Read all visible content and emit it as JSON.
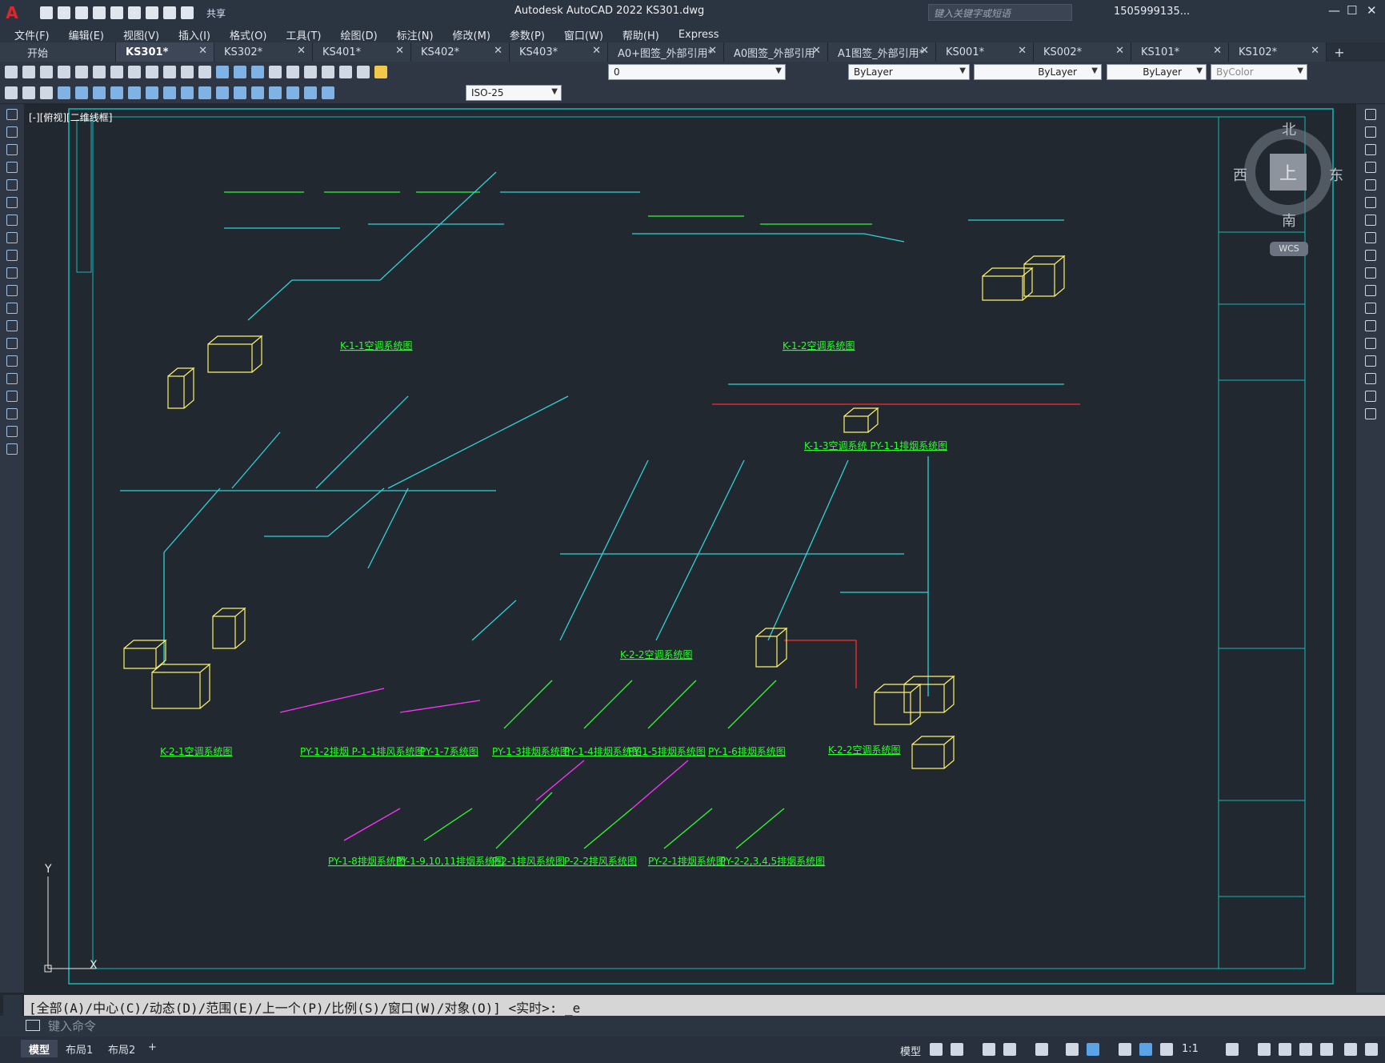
{
  "app": {
    "logo_letter": "A",
    "title": "Autodesk AutoCAD 2022    KS301.dwg",
    "share_label": "共享",
    "search_placeholder": "键入关键字或短语",
    "user": "1505999135..."
  },
  "menu": [
    "文件(F)",
    "编辑(E)",
    "视图(V)",
    "插入(I)",
    "格式(O)",
    "工具(T)",
    "绘图(D)",
    "标注(N)",
    "修改(M)",
    "参数(P)",
    "窗口(W)",
    "帮助(H)",
    "Express"
  ],
  "tabs": [
    {
      "label": "开始",
      "active": false,
      "closable": false
    },
    {
      "label": "KS301*",
      "active": true,
      "closable": true
    },
    {
      "label": "KS302*",
      "active": false,
      "closable": true
    },
    {
      "label": "KS401*",
      "active": false,
      "closable": true
    },
    {
      "label": "KS402*",
      "active": false,
      "closable": true
    },
    {
      "label": "KS403*",
      "active": false,
      "closable": true
    },
    {
      "label": "A0+图签_外部引用*",
      "active": false,
      "closable": true
    },
    {
      "label": "A0图签_外部引用",
      "active": false,
      "closable": true
    },
    {
      "label": "A1图签_外部引用*",
      "active": false,
      "closable": true
    },
    {
      "label": "KS001*",
      "active": false,
      "closable": true
    },
    {
      "label": "KS002*",
      "active": false,
      "closable": true
    },
    {
      "label": "KS101*",
      "active": false,
      "closable": true
    },
    {
      "label": "KS102*",
      "active": false,
      "closable": true
    }
  ],
  "properties": {
    "layer": "0",
    "color": "ByLayer",
    "linetype": "ByLayer",
    "lineweight": "ByLayer",
    "plotstyle": "ByColor",
    "dimstyle": "ISO-25"
  },
  "viewport": {
    "label": "[-][俯视][二维线框]",
    "cube_top": "上",
    "north": "北",
    "south": "南",
    "east": "东",
    "west": "西",
    "wcs": "WCS"
  },
  "drawing_titles": [
    "K-1-1空调系统图",
    "K-1-2空调系统图",
    "K-1-3空调系统 PY-1-1排烟系统图",
    "K-2-2空调系统图",
    "K-2-1空调系统图",
    "PY-1-2排烟 P-1-1排风系统图",
    "PY-1-7系统图",
    "PY-1-3排烟系统图",
    "PY-1-4排烟系统图",
    "PY-1-5排烟系统图",
    "PY-1-6排烟系统图",
    "K-2-2空调系统图",
    "PY-1-8排烟系统图",
    "PY-1-9,10,11排烟系统图",
    "P-2-1排风系统图",
    "P-2-2排风系统图",
    "PY-2-1排烟系统图",
    "PY-2-2,3,4,5排烟系统图"
  ],
  "command": {
    "history": "[全部(A)/中心(C)/动态(D)/范围(E)/上一个(P)/比例(S)/窗口(W)/对象(O)] <实时>: _e",
    "placeholder": "键入命令"
  },
  "layouts": [
    "模型",
    "布局1",
    "布局2"
  ],
  "status": {
    "model_label": "模型",
    "scale": "1:1"
  },
  "colors": {
    "cyan": "#2fd3d6",
    "green": "#2cff2c",
    "yellow": "#fff36a",
    "red": "#ff2a2a",
    "magenta": "#ff33ff",
    "frame": "#15b8b8"
  }
}
